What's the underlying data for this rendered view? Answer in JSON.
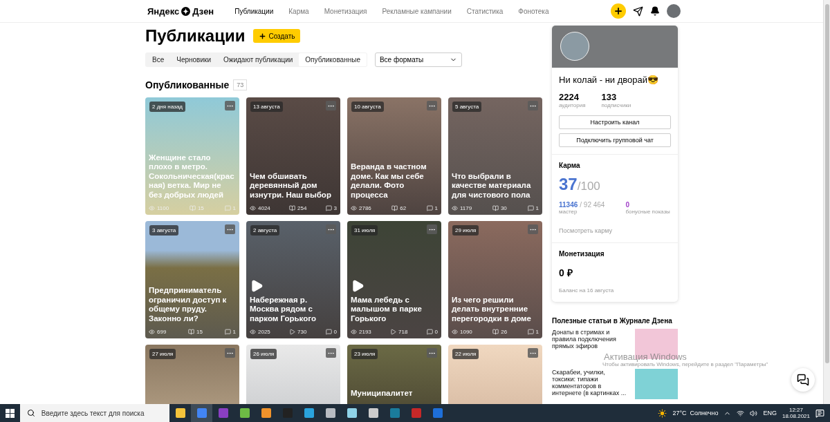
{
  "header": {
    "logo_left": "Яндекс",
    "logo_right": "Дзен",
    "nav": [
      {
        "label": "Публикации",
        "selected": true
      },
      {
        "label": "Карма",
        "selected": false
      },
      {
        "label": "Монетизация",
        "selected": false
      },
      {
        "label": "Рекламные кампании",
        "selected": false
      },
      {
        "label": "Статистика",
        "selected": false
      },
      {
        "label": "Фонотека",
        "selected": false
      }
    ]
  },
  "page": {
    "title": "Публикации",
    "create_button": "Создать",
    "filters": [
      {
        "label": "Все",
        "selected": false
      },
      {
        "label": "Черновики",
        "selected": false
      },
      {
        "label": "Ожидают публикации",
        "selected": false
      },
      {
        "label": "Опубликованные",
        "selected": true
      }
    ],
    "format_select": "Все форматы",
    "section_title": "Опубликованные",
    "section_count": "73",
    "cards": [
      {
        "date": "2 дня назад",
        "video": false,
        "title": "Женщине стало плохо в метро. Сокольническая(красная) ветка. Мир не без добрых людей",
        "stats": [
          {
            "kind": "views",
            "value": "1100"
          },
          {
            "kind": "reads",
            "value": "15"
          },
          {
            "kind": "comments",
            "value": "1"
          }
        ]
      },
      {
        "date": "13 августа",
        "video": false,
        "title": "Чем обшивать деревянный дом изнутри. Наш выбор",
        "stats": [
          {
            "kind": "views",
            "value": "4024"
          },
          {
            "kind": "reads",
            "value": "254"
          },
          {
            "kind": "comments",
            "value": "3"
          }
        ]
      },
      {
        "date": "10 августа",
        "video": false,
        "title": "Веранда в частном доме. Как мы себе делали. Фото процесса",
        "stats": [
          {
            "kind": "views",
            "value": "2786"
          },
          {
            "kind": "reads",
            "value": "62"
          },
          {
            "kind": "comments",
            "value": "1"
          }
        ]
      },
      {
        "date": "5 августа",
        "video": false,
        "title": "Что выбрали в качестве материала для чистового пола",
        "stats": [
          {
            "kind": "views",
            "value": "1179"
          },
          {
            "kind": "reads",
            "value": "30"
          },
          {
            "kind": "comments",
            "value": "1"
          }
        ]
      },
      {
        "date": "3 августа",
        "video": false,
        "title": "Предприниматель ограничил доступ к общему пруду. Законно ли?",
        "stats": [
          {
            "kind": "views",
            "value": "699"
          },
          {
            "kind": "reads",
            "value": "15"
          },
          {
            "kind": "comments",
            "value": "1"
          }
        ]
      },
      {
        "date": "2 августа",
        "video": true,
        "title": "Набережная р. Москва рядом с парком Горького",
        "stats": [
          {
            "kind": "views",
            "value": "2025"
          },
          {
            "kind": "plays",
            "value": "730"
          },
          {
            "kind": "comments",
            "value": "0"
          }
        ]
      },
      {
        "date": "31 июля",
        "video": true,
        "title": "Мама лебедь с малышом в парке Горького",
        "stats": [
          {
            "kind": "views",
            "value": "2193"
          },
          {
            "kind": "plays",
            "value": "718"
          },
          {
            "kind": "comments",
            "value": "0"
          }
        ]
      },
      {
        "date": "29 июля",
        "video": false,
        "title": "Из чего решили делать внутренние перегородки в доме",
        "stats": [
          {
            "kind": "views",
            "value": "1090"
          },
          {
            "kind": "reads",
            "value": "26"
          },
          {
            "kind": "comments",
            "value": "1"
          }
        ]
      },
      {
        "date": "27 июля"
      },
      {
        "date": "26 июля"
      },
      {
        "date": "23 июля",
        "title": "Муниципалитет"
      },
      {
        "date": "22 июля"
      }
    ]
  },
  "channel": {
    "name": "Ни колай - ни дворай😎",
    "stats": [
      {
        "value": "2224",
        "label": "аудитория"
      },
      {
        "value": "133",
        "label": "подписчики"
      }
    ],
    "buttons": [
      "Настроить канал",
      "Подключить групповой чат"
    ],
    "karma": {
      "title": "Карма",
      "score": "37",
      "max": "/100",
      "progress": "11346",
      "progress_total": "/ 92 464",
      "progress_label": "мастер",
      "bonus": "0",
      "bonus_label": "бонусные показы",
      "link": "Посмотреть карму"
    },
    "monetization": {
      "title": "Монетизация",
      "amount": "0 ₽",
      "note": "Баланс на 16 августа"
    }
  },
  "articles": {
    "title": "Полезные статьи в Журнале Дзена",
    "items": [
      "Донаты в стримах и правила подключения прямых эфиров",
      "Скарабеи, училки, токсики: типажи комментаторов в интернете (в картинках ..."
    ]
  },
  "activation": {
    "title": "Активация Windows",
    "text": "Чтобы активировать Windows, перейдите в раздел \"Параметры\""
  },
  "taskbar": {
    "search_placeholder": "Введите здесь текст для поиска",
    "weather": "27°C  Солнечно",
    "language": "ENG",
    "time": "12:27",
    "date": "18.08.2021"
  }
}
